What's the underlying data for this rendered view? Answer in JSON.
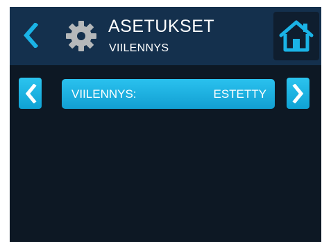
{
  "header": {
    "title": "ASETUKSET",
    "subtitle": "VIILENNYS",
    "icons": {
      "back": "chevron-left-icon",
      "settings": "gear-icon",
      "home": "home-icon"
    }
  },
  "setting": {
    "label": "VIILENNYS:",
    "value": "ESTETTY"
  },
  "colors": {
    "background": "#0d1824",
    "header": "#14304d",
    "accent": "#1ab3e6",
    "gear": "#b5b8ba",
    "text": "#ffffff"
  }
}
